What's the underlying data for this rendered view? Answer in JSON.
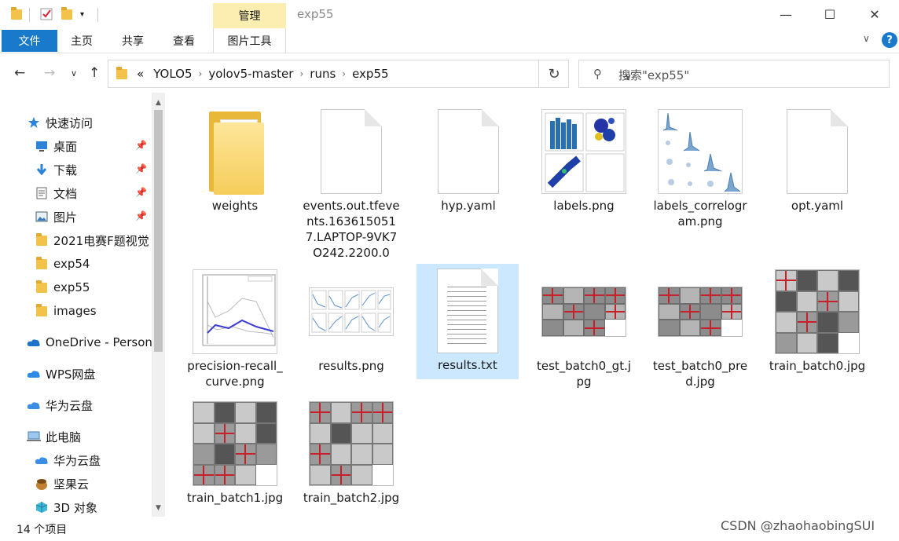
{
  "titlebar": {
    "manage_tab": "管理",
    "window_title": "exp55",
    "minimize": "—",
    "maximize": "☐",
    "close": "✕"
  },
  "ribbon": {
    "file": "文件",
    "home": "主页",
    "share": "共享",
    "view": "查看",
    "picture_tools": "图片工具"
  },
  "address": {
    "overflow": "«",
    "crumbs": [
      "YOLO5",
      "yolov5-master",
      "runs",
      "exp55"
    ],
    "search_placeholder": "搜索\"exp55\""
  },
  "sidebar": {
    "quick_access": "快速访问",
    "items": [
      {
        "label": "桌面",
        "icon": "desktop-icon",
        "pinned": true
      },
      {
        "label": "下载",
        "icon": "download-icon",
        "pinned": true
      },
      {
        "label": "文档",
        "icon": "document-icon",
        "pinned": true
      },
      {
        "label": "图片",
        "icon": "picture-icon",
        "pinned": true
      },
      {
        "label": "2021电赛F题视觉",
        "icon": "folder-icon",
        "pinned": false
      },
      {
        "label": "exp54",
        "icon": "folder-icon",
        "pinned": false
      },
      {
        "label": "exp55",
        "icon": "folder-icon",
        "pinned": false
      },
      {
        "label": "images",
        "icon": "folder-icon",
        "pinned": false
      }
    ],
    "onedrive": "OneDrive - Person",
    "wps": "WPS网盘",
    "huawei_cloud": "华为云盘",
    "this_pc": "此电脑",
    "pc_items": [
      {
        "label": "华为云盘",
        "icon": "huawei-cloud-icon"
      },
      {
        "label": "坚果云",
        "icon": "nutstore-icon"
      },
      {
        "label": "3D 对象",
        "icon": "3d-objects-icon"
      }
    ]
  },
  "files": [
    {
      "name": "weights",
      "type": "folder"
    },
    {
      "name": "events.out.tfevents.1636150517.LAPTOP-9VK7O242.2200.0",
      "type": "doc"
    },
    {
      "name": "hyp.yaml",
      "type": "doc"
    },
    {
      "name": "labels.png",
      "type": "image"
    },
    {
      "name": "labels_correlogram.png",
      "type": "image"
    },
    {
      "name": "opt.yaml",
      "type": "doc"
    },
    {
      "name": "precision-recall_curve.png",
      "type": "image"
    },
    {
      "name": "results.png",
      "type": "image"
    },
    {
      "name": "results.txt",
      "type": "text",
      "selected": true
    },
    {
      "name": "test_batch0_gt.jpg",
      "type": "image"
    },
    {
      "name": "test_batch0_pred.jpg",
      "type": "image"
    },
    {
      "name": "train_batch0.jpg",
      "type": "image"
    },
    {
      "name": "train_batch1.jpg",
      "type": "image"
    },
    {
      "name": "train_batch2.jpg",
      "type": "image"
    }
  ],
  "status": {
    "item_count": "14 个项目"
  },
  "watermark": "CSDN @zhaohaobingSUI",
  "colors": {
    "accent": "#1979ca",
    "manage_tab": "#fcedb0",
    "selection": "#cce8ff",
    "folder": "#f6cd5a"
  }
}
